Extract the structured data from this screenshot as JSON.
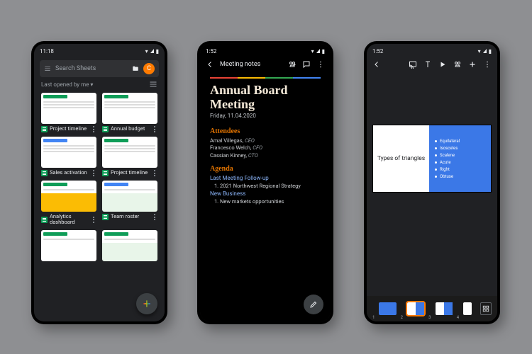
{
  "phone1": {
    "status_time": "11:18",
    "search_placeholder": "Search Sheets",
    "avatar_letter": "C",
    "filter_label": "Last opened by me",
    "docs": [
      {
        "name": "Project timeline"
      },
      {
        "name": "Annual budget"
      },
      {
        "name": "Sales activation"
      },
      {
        "name": "Project timeline"
      },
      {
        "name": "Analytics dashboard"
      },
      {
        "name": "Team roster"
      }
    ]
  },
  "phone2": {
    "status_time": "1:52",
    "doc_name": "Meeting notes",
    "title": "Annual Board Meeting",
    "date": "Friday, 11.04.2020",
    "section_attendees": "Attendees",
    "attendees": [
      {
        "name": "Amal Villegas",
        "role": "CEO"
      },
      {
        "name": "Francesco Welch",
        "role": "CFO"
      },
      {
        "name": "Cassian Kinney",
        "role": "CTO"
      }
    ],
    "section_agenda": "Agenda",
    "agenda_sub1": "Last Meeting Follow-up",
    "agenda_items1": [
      "2021 Northwest Regional Strategy"
    ],
    "agenda_sub2": "New Business",
    "agenda_items2": [
      "New markets opportunities"
    ]
  },
  "phone3": {
    "status_time": "1:52",
    "slide_title": "Types of triangles",
    "bullets": [
      "Equilateral",
      "Isosceles",
      "Scalene",
      "Acute",
      "Right",
      "Obtuse"
    ],
    "filmstrip": [
      "1",
      "2",
      "3",
      "4"
    ]
  }
}
